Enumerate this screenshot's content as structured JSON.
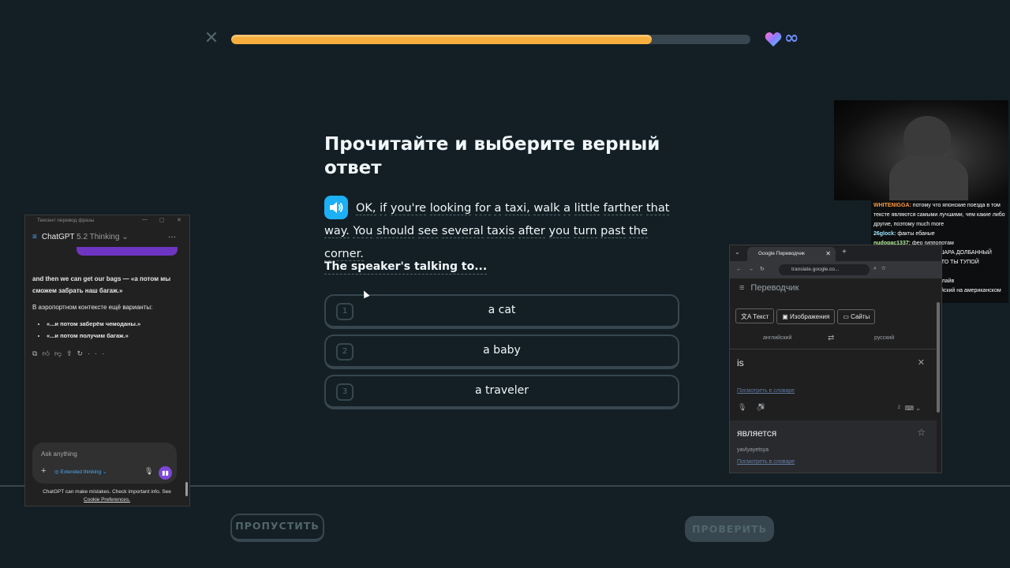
{
  "lesson": {
    "progress_fraction": 0.81,
    "progress_color": "#f7ae3c",
    "hearts_label": "∞",
    "title": "Прочитайте и выберите верный ответ",
    "passage_words": [
      "OK,",
      "if",
      "you're",
      "looking",
      "for",
      "a",
      "taxi,",
      "walk",
      "a",
      "little",
      "farther",
      "that",
      "way.",
      "You",
      "should",
      "see",
      "several",
      "taxis",
      "after",
      "you",
      "turn",
      "past",
      "the",
      "corner."
    ],
    "question": "The speaker's talking to...",
    "options": [
      {
        "num": "1",
        "label": "a cat"
      },
      {
        "num": "2",
        "label": "a baby"
      },
      {
        "num": "3",
        "label": "a traveler"
      }
    ],
    "skip_label": "ПРОПУСТИТЬ",
    "check_label": "ПРОВЕРИТЬ",
    "icons": {
      "close": "close-icon",
      "heart": "heart-icon",
      "speaker": "speaker-icon"
    }
  },
  "chatgpt": {
    "window_title": "Тексент перевод фразы",
    "header_title": "ChatGPT",
    "header_version": "5.2 Thinking",
    "message_line1": "and then we can get our bags — «а потом мы сможем забрать наш багаж.»",
    "message_line2": "В аэропортном контексте ещё варианты:",
    "bullets": [
      "«...и потом заберём чемоданы.»",
      "«...и потом получим багаж.»"
    ],
    "input_placeholder": "Ask anything",
    "extended_thinking": "Extended thinking",
    "footer_text": "ChatGPT can make mistakes. Check important info. See",
    "footer_link": "Cookie Preferences."
  },
  "chat_overlay": {
    "messages": [
      {
        "user": "WHITENIGGA:",
        "color": "#ff9a3c",
        "text": "потому что японские поезда в том тексте являются самыми лучшими, чем какие либо другие, поэтому much more"
      },
      {
        "user": "26glock:",
        "color": "#9be7ff",
        "text": "факты ебаные"
      },
      {
        "user": "nudopac1337:",
        "color": "#b7f0a0",
        "text": "фео гиппопотам"
      },
      {
        "user": "freeBLOGER:",
        "color": "#9be7ff",
        "text": "ФЕО ПЕТУШАРА ДОЛБАННЫЙ"
      },
      {
        "user": "nudopac1337:",
        "color": "#b7f0a0",
        "text": "ПОТОМУ ЧТО ТЫ ТУПОЙ"
      },
      {
        "user": "nudopac1337:",
        "color": "#b7f0a0",
        "text": "ЗАТУПОК"
      },
      {
        "user": "pacanchotkiy:",
        "color": "#d68cff",
        "text": "пошли в вк лайв"
      },
      {
        "user": "nudopac1337:",
        "color": "#b7f0a0",
        "text": "учим английский на американском платформе"
      }
    ]
  },
  "translate": {
    "tab_title": "Google Переводчик",
    "url": "translate.google.co...",
    "app_title": "Переводчик",
    "modes": [
      "Текст",
      "Изображения",
      "Сайты"
    ],
    "source_lang": "английский",
    "target_lang": "русский",
    "source_text": "is",
    "source_dict_link": "Посмотреть в словаре",
    "char_count": "2",
    "output_text": "является",
    "transliteration": "yavlyayetsya",
    "output_dict_link": "Посмотреть в словаре"
  }
}
